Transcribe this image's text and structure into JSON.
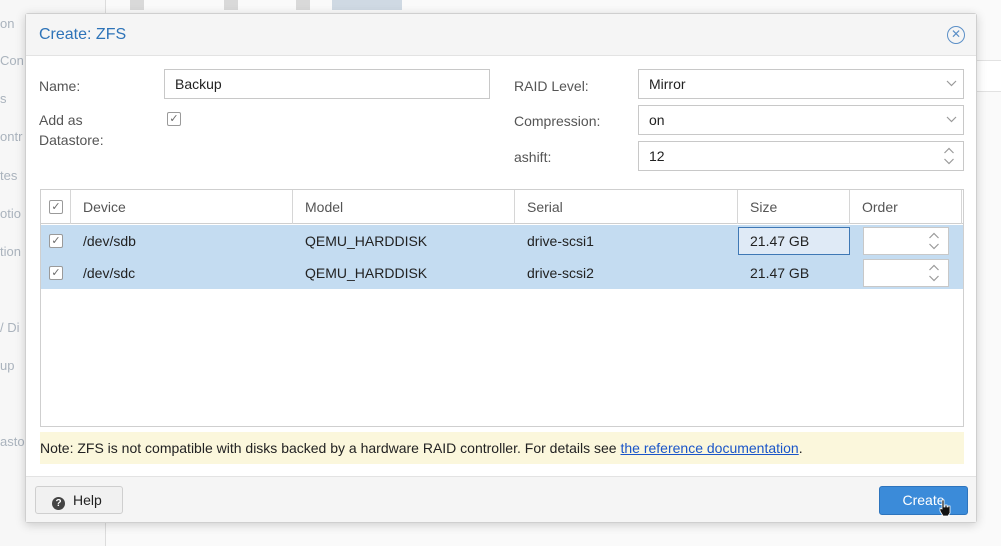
{
  "background": {
    "sidebar_fragments": [
      "on",
      "Con",
      "s",
      "ontr",
      "tes",
      "otio",
      "tion",
      "/ Di",
      "up",
      "asto"
    ]
  },
  "dialog": {
    "title": "Create: ZFS",
    "close_icon": "close-circle-icon"
  },
  "form": {
    "name_label": "Name:",
    "name_value": "Backup",
    "add_datastore_label_1": "Add as",
    "add_datastore_label_2": "Datastore:",
    "add_datastore_checked": true,
    "raid_label": "RAID Level:",
    "raid_value": "Mirror",
    "compression_label": "Compression:",
    "compression_value": "on",
    "ashift_label": "ashift:",
    "ashift_value": "12"
  },
  "grid": {
    "columns": [
      "Device",
      "Model",
      "Serial",
      "Size",
      "Order"
    ],
    "rows": [
      {
        "checked": true,
        "device": "/dev/sdb",
        "model": "QEMU_HARDDISK",
        "serial": "drive-scsi1",
        "size": "21.47 GB",
        "order": ""
      },
      {
        "checked": true,
        "device": "/dev/sdc",
        "model": "QEMU_HARDDISK",
        "serial": "drive-scsi2",
        "size": "21.47 GB",
        "order": ""
      }
    ]
  },
  "note": {
    "text": "Note: ZFS is not compatible with disks backed by a hardware RAID controller. For details see ",
    "link": "the reference documentation",
    "suffix": "."
  },
  "footer": {
    "help_label": "Help",
    "create_label": "Create"
  },
  "colors": {
    "accent": "#2d73b8",
    "selected_row": "#c4dcf1",
    "primary_button": "#3b8bd9",
    "note_background": "#fbf7dc"
  }
}
